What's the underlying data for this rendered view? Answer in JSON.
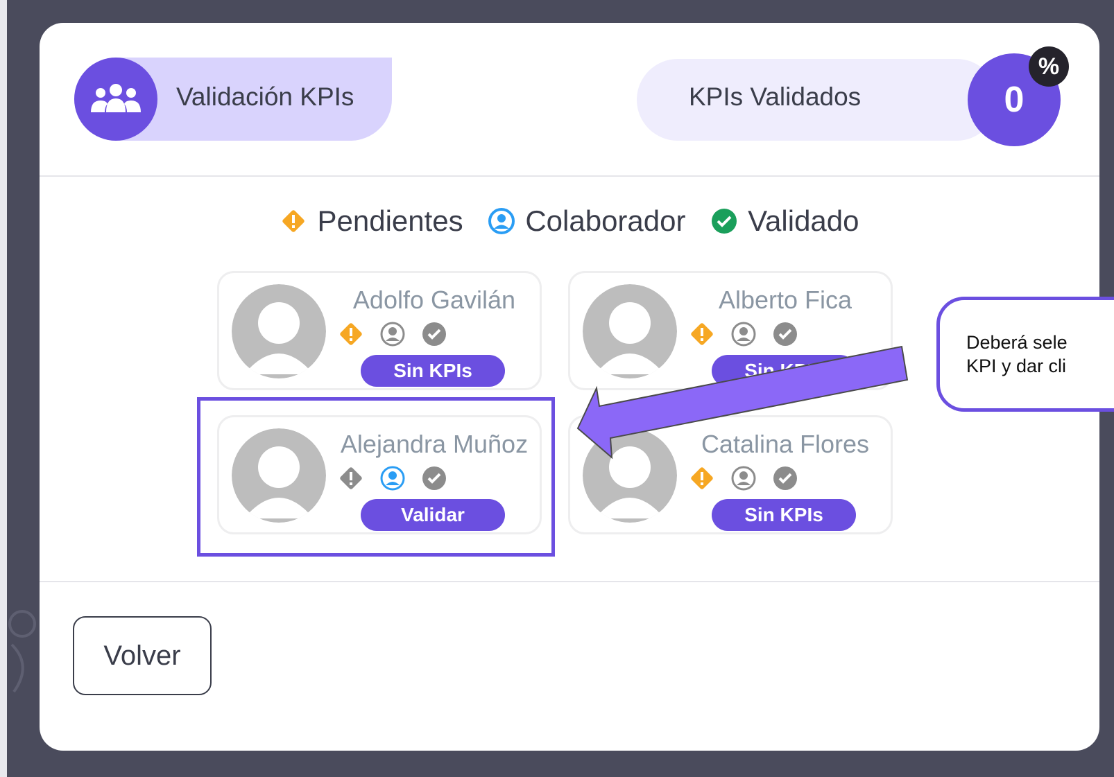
{
  "header": {
    "title": "Validación KPIs",
    "stat_label": "KPIs Validados",
    "stat_value": "0",
    "stat_badge": "%"
  },
  "legend": [
    {
      "label": "Pendientes",
      "icon": "diamond-alert-icon",
      "color": "#f6a723"
    },
    {
      "label": "Colaborador",
      "icon": "user-circle-icon",
      "color": "#2a9df4"
    },
    {
      "label": "Validado",
      "icon": "check-circle-icon",
      "color": "#1a9f5b"
    }
  ],
  "cards": [
    {
      "name": "Adolfo Gavilán",
      "button": "Sin KPIs",
      "pending_active": true,
      "collab_active": false
    },
    {
      "name": "Alberto Fica",
      "button": "Sin KPIs",
      "pending_active": true,
      "collab_active": false
    },
    {
      "name": "Alejandra Muñoz",
      "button": "Validar",
      "pending_active": false,
      "collab_active": true
    },
    {
      "name": "Catalina Flores",
      "button": "Sin KPIs",
      "pending_active": true,
      "collab_active": false
    }
  ],
  "footer": {
    "back_label": "Volver"
  },
  "callout": {
    "text": "Deberá sele\nKPI y dar cli"
  },
  "colors": {
    "accent": "#6b4fe0",
    "accent_light": "#d9d3fd",
    "pending": "#f6a723",
    "collab": "#2a9df4",
    "validated": "#1a9f5b",
    "inactive": "#8c8c8c"
  }
}
